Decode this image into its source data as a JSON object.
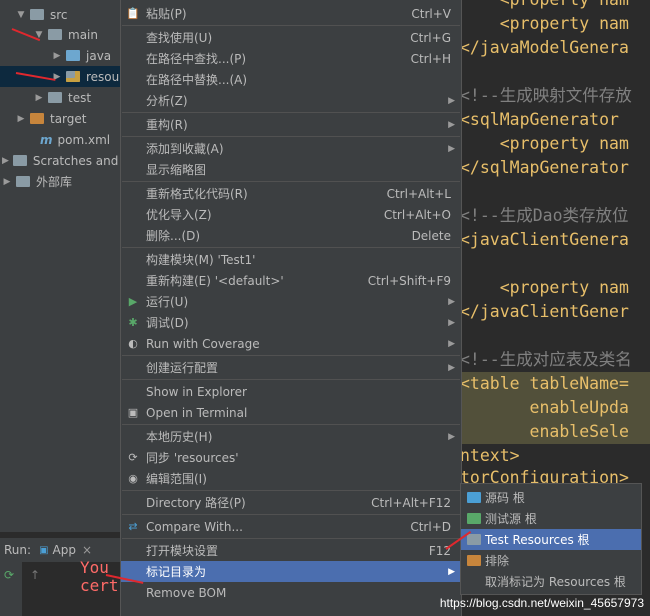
{
  "tree": [
    {
      "label": "src",
      "arrow": "▼",
      "folder": "grey",
      "indent": 16
    },
    {
      "label": "main",
      "arrow": "▼",
      "folder": "grey",
      "indent": 34
    },
    {
      "label": "java",
      "arrow": "▶",
      "folder": "blue",
      "indent": 52
    },
    {
      "label": "resources",
      "arrow": "▶",
      "folder": "res",
      "indent": 52
    },
    {
      "label": "test",
      "arrow": "▶",
      "folder": "grey",
      "indent": 34
    },
    {
      "label": "target",
      "arrow": "▶",
      "folder": "orange",
      "indent": 16
    },
    {
      "label": "pom.xml",
      "arrow": "",
      "folder": "m",
      "indent": 26
    },
    {
      "label": "Scratches and Consoles",
      "arrow": "▶",
      "folder": "grey",
      "indent": 2
    },
    {
      "label": "外部库",
      "arrow": "▶",
      "folder": "grey",
      "indent": 2
    }
  ],
  "editor_lines": [
    {
      "text": "    <property nam",
      "cls": "tag"
    },
    {
      "text": "    <property nam",
      "cls": "tag"
    },
    {
      "text": "</javaModelGenera",
      "cls": "tag"
    },
    {
      "text": "",
      "cls": ""
    },
    {
      "text": "<!--生成映射文件存放",
      "cls": "cmt"
    },
    {
      "text": "<sqlMapGenerator",
      "cls": "tag"
    },
    {
      "text": "    <property nam",
      "cls": "tag"
    },
    {
      "text": "</sqlMapGenerator",
      "cls": "tag"
    },
    {
      "text": "",
      "cls": ""
    },
    {
      "text": "<!--生成Dao类存放位",
      "cls": "cmt"
    },
    {
      "text": "<javaClientGenera",
      "cls": "tag"
    },
    {
      "text": "",
      "cls": ""
    },
    {
      "text": "    <property nam",
      "cls": "tag"
    },
    {
      "text": "</javaClientGener",
      "cls": "tag"
    },
    {
      "text": "",
      "cls": ""
    },
    {
      "text": "<!--生成对应表及类名",
      "cls": "cmt"
    },
    {
      "text": "<table tableName=",
      "cls": "tag hl"
    },
    {
      "text": "       enableUpda",
      "cls": "tag hl"
    },
    {
      "text": "       enableSele",
      "cls": "tag hl"
    },
    {
      "text": "ntext>",
      "cls": "tag"
    },
    {
      "text": "torConfiguration>",
      "cls": "tag"
    }
  ],
  "menu_items": [
    {
      "label": "粘贴(P)",
      "shortcut": "Ctrl+V",
      "icon": "📋",
      "sep_after": true
    },
    {
      "label": "查找使用(U)",
      "shortcut": "Ctrl+G",
      "icon": ""
    },
    {
      "label": "在路径中查找...(P)",
      "shortcut": "Ctrl+H",
      "icon": ""
    },
    {
      "label": "在路径中替换...(A)",
      "shortcut": "",
      "icon": ""
    },
    {
      "label": "分析(Z)",
      "shortcut": "",
      "icon": "",
      "sub": true,
      "sep_after": true
    },
    {
      "label": "重构(R)",
      "shortcut": "",
      "icon": "",
      "sub": true,
      "sep_after": true
    },
    {
      "label": "添加到收藏(A)",
      "shortcut": "",
      "icon": "",
      "sub": true
    },
    {
      "label": "显示缩略图",
      "shortcut": "",
      "icon": "",
      "sep_after": true
    },
    {
      "label": "重新格式化代码(R)",
      "shortcut": "Ctrl+Alt+L",
      "icon": ""
    },
    {
      "label": "优化导入(Z)",
      "shortcut": "Ctrl+Alt+O",
      "icon": ""
    },
    {
      "label": "删除...(D)",
      "shortcut": "Delete",
      "icon": "",
      "sep_after": true
    },
    {
      "label": "构建模块(M) 'Test1'",
      "shortcut": "",
      "icon": ""
    },
    {
      "label": "重新构建(E) '<default>'",
      "shortcut": "Ctrl+Shift+F9",
      "icon": ""
    },
    {
      "label": "运行(U)",
      "shortcut": "",
      "icon": "▶",
      "icon_color": "#59a869",
      "sub": true
    },
    {
      "label": "调试(D)",
      "shortcut": "",
      "icon": "✱",
      "icon_color": "#59a869",
      "sub": true
    },
    {
      "label": "Run with Coverage",
      "shortcut": "",
      "icon": "◐",
      "icon_color": "#bbbbbb",
      "sub": true,
      "sep_after": true
    },
    {
      "label": "创建运行配置",
      "shortcut": "",
      "icon": "",
      "sub": true,
      "sep_after": true
    },
    {
      "label": "Show in Explorer",
      "shortcut": "",
      "icon": ""
    },
    {
      "label": "Open in Terminal",
      "shortcut": "",
      "icon": "▣",
      "icon_color": "#bbbbbb",
      "sep_after": true
    },
    {
      "label": "本地历史(H)",
      "shortcut": "",
      "icon": "",
      "sub": true
    },
    {
      "label": "同步 'resources'",
      "shortcut": "",
      "icon": "⟳",
      "icon_color": "#bbbbbb"
    },
    {
      "label": "编辑范围(I)",
      "shortcut": "",
      "icon": "◉",
      "icon_color": "#bbbbbb",
      "sep_after": true
    },
    {
      "label": "Directory 路径(P)",
      "shortcut": "Ctrl+Alt+F12",
      "icon": "",
      "sep_after": true
    },
    {
      "label": "Compare With...",
      "shortcut": "Ctrl+D",
      "icon": "⇄",
      "icon_color": "#4b9fd5",
      "sep_after": true
    },
    {
      "label": "打开模块设置",
      "shortcut": "F12",
      "icon": ""
    },
    {
      "label": "标记目录为",
      "shortcut": "",
      "icon": "",
      "sub": true,
      "active": true
    },
    {
      "label": "Remove BOM",
      "shortcut": "",
      "icon": ""
    }
  ],
  "submenu_items": [
    {
      "label": "源码 根",
      "color": "#4b9fd5"
    },
    {
      "label": "测试源 根",
      "color": "#59a869"
    },
    {
      "label": "Test Resources 根",
      "color": "#8a9ba5",
      "active": true
    },
    {
      "label": "排除",
      "color": "#c7853c"
    },
    {
      "label": "取消标记为 Resources 根",
      "color": ""
    }
  ],
  "run_bar": {
    "label": "Run:",
    "tab": "App",
    "close": "×"
  },
  "console_text": [
    "You",
    "cert"
  ],
  "watermark": "https://blog.csdn.net/weixin_45657973",
  "colors": {
    "menu_bg": "#3c3f41",
    "active": "#4b6eaf",
    "annotation": "#e0282e"
  }
}
